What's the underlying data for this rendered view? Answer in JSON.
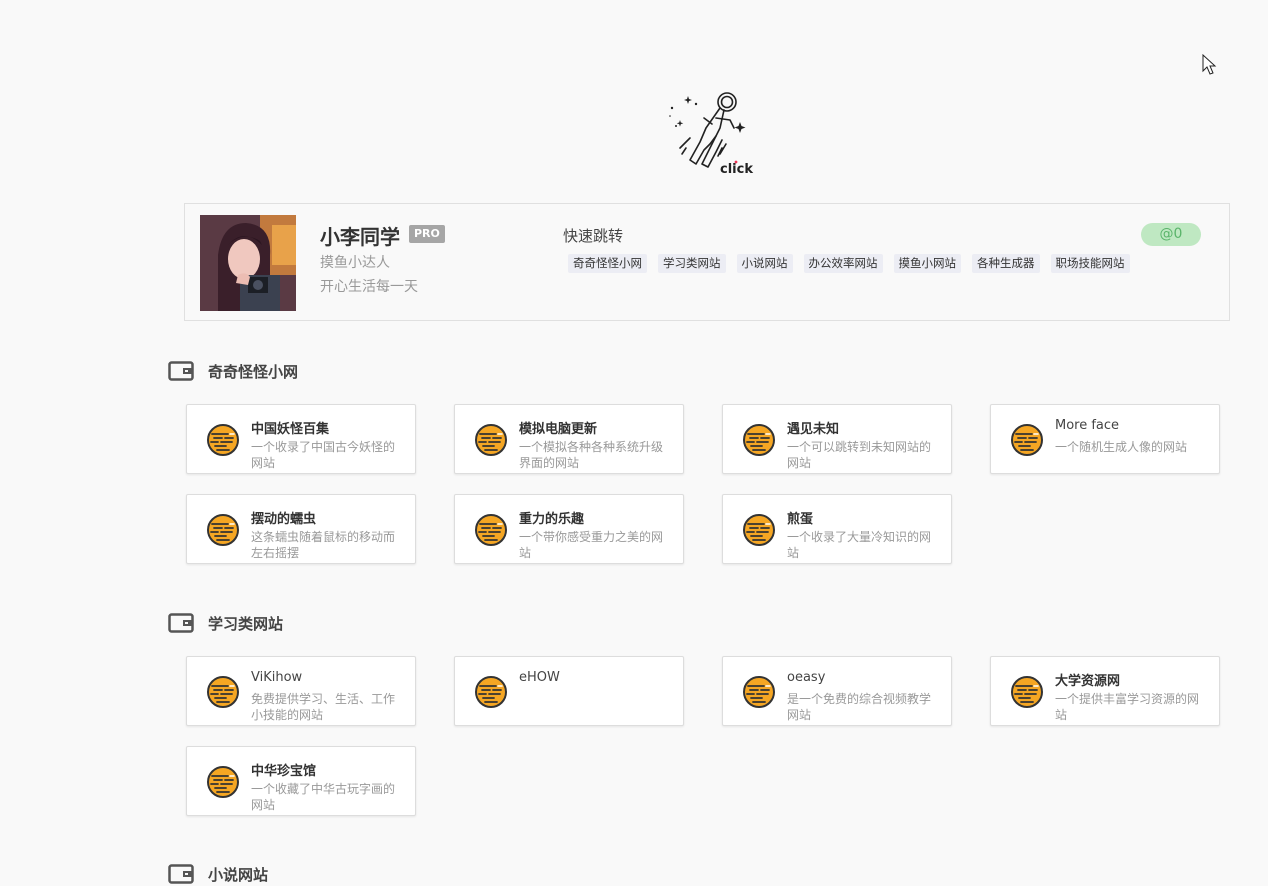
{
  "profile": {
    "name": "小李同学",
    "badge": "PRO",
    "subtitle": "摸鱼小达人",
    "motto": "开心生活每一天"
  },
  "astronaut": {
    "label": "click",
    "icon": "astronaut-icon"
  },
  "quick_jump": {
    "title": "快速跳转",
    "counter": "@0",
    "links": [
      "奇奇怪怪小网",
      "学习类网站",
      "小说网站",
      "办公效率网站",
      "摸鱼小网站",
      "各种生成器",
      "职场技能网站"
    ]
  },
  "sections": [
    {
      "title": "奇奇怪怪小网",
      "icon": "wallet-icon",
      "items": [
        {
          "title": "中国妖怪百集",
          "desc": "一个收录了中国古今妖怪的网站"
        },
        {
          "title": "模拟电脑更新",
          "desc": "一个模拟各种各种系统升级界面的网站"
        },
        {
          "title": "遇见未知",
          "desc": "一个可以跳转到未知网站的网站"
        },
        {
          "title": "More face",
          "desc": "一个随机生成人像的网站"
        },
        {
          "title": "摆动的蠕虫",
          "desc": "这条蠕虫随着鼠标的移动而左右摇摆"
        },
        {
          "title": "重力的乐趣",
          "desc": "一个带你感受重力之美的网站"
        },
        {
          "title": "煎蛋",
          "desc": "一个收录了大量冷知识的网站"
        }
      ]
    },
    {
      "title": "学习类网站",
      "icon": "wallet-icon",
      "items": [
        {
          "title": "ViKihow",
          "desc": "免费提供学习、生活、工作小技能的网站"
        },
        {
          "title": "eHOW",
          "desc": ""
        },
        {
          "title": "oeasy",
          "desc": "是一个免费的综合视频教学网站"
        },
        {
          "title": "大学资源网",
          "desc": "一个提供丰富学习资源的网站"
        },
        {
          "title": "中华珍宝馆",
          "desc": "一个收藏了中华古玩字画的网站"
        }
      ]
    },
    {
      "title": "小说网站",
      "icon": "wallet-icon",
      "items": []
    }
  ],
  "colors": {
    "accent_green": "#bfe8c2",
    "site_icon": "#f5a623",
    "tag_bg": "#ecedf4"
  },
  "site_icon_name": "planet-icon"
}
